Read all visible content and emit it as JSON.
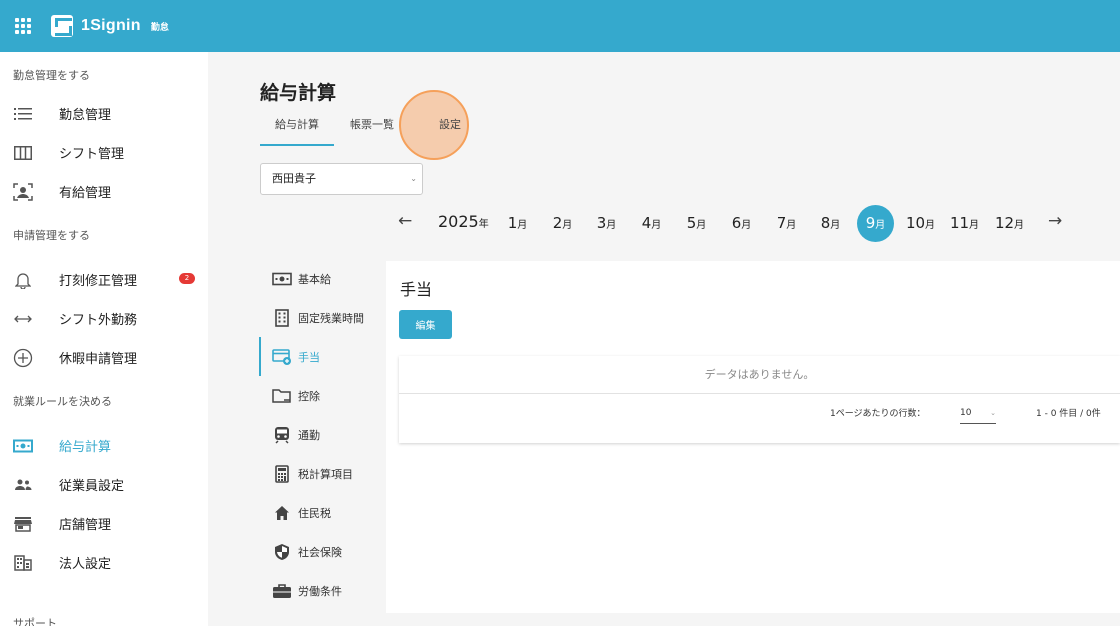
{
  "app": {
    "name": "1Signin",
    "sub": "勤怠"
  },
  "sidebar": {
    "sections": [
      {
        "title": "勤怠管理をする",
        "items": [
          {
            "label": "勤怠管理",
            "icon": "list-icon"
          },
          {
            "label": "シフト管理",
            "icon": "columns-icon"
          },
          {
            "label": "有給管理",
            "icon": "person-frame-icon"
          }
        ]
      },
      {
        "title": "申請管理をする",
        "items": [
          {
            "label": "打刻修正管理",
            "icon": "bell-icon",
            "badge": "2"
          },
          {
            "label": "シフト外勤務",
            "icon": "swap-arrows-icon"
          },
          {
            "label": "休暇申請管理",
            "icon": "plus-circle-icon"
          }
        ]
      },
      {
        "title": "就業ルールを決める",
        "items": [
          {
            "label": "給与計算",
            "icon": "money-icon",
            "active": true
          },
          {
            "label": "従業員設定",
            "icon": "people-icon"
          },
          {
            "label": "店舗管理",
            "icon": "store-icon"
          },
          {
            "label": "法人設定",
            "icon": "building-icon"
          }
        ]
      },
      {
        "title": "サポート",
        "items": []
      }
    ]
  },
  "page": {
    "title": "給与計算",
    "tabs": [
      {
        "label": "給与計算",
        "active": true
      },
      {
        "label": "帳票一覧"
      },
      {
        "label": "設定"
      }
    ],
    "employee_select": "西田貴子"
  },
  "month_nav": {
    "year": "2025",
    "year_suffix": "年",
    "month_suffix": "月",
    "months": [
      "1",
      "2",
      "3",
      "4",
      "5",
      "6",
      "7",
      "8",
      "9",
      "10",
      "11",
      "12"
    ],
    "selected": "9"
  },
  "subnav": [
    {
      "label": "基本給",
      "icon": "cash-icon"
    },
    {
      "label": "固定残業時間",
      "icon": "office-building-icon"
    },
    {
      "label": "手当",
      "icon": "card-plus-icon",
      "active": true
    },
    {
      "label": "控除",
      "icon": "folder-minus-icon"
    },
    {
      "label": "通勤",
      "icon": "train-icon"
    },
    {
      "label": "税計算項目",
      "icon": "calculator-icon"
    },
    {
      "label": "住民税",
      "icon": "home-icon"
    },
    {
      "label": "社会保険",
      "icon": "shield-icon"
    },
    {
      "label": "労働条件",
      "icon": "briefcase-icon"
    }
  ],
  "panel": {
    "title": "手当",
    "edit_label": "編集",
    "empty_message": "データはありません。",
    "rows_per_page_label": "1ページあたりの行数：",
    "rows_per_page": "10",
    "page_info": "1 - 0 件目 / 0件"
  },
  "colors": {
    "primary": "#35a9cd",
    "highlight": "#f5b07d",
    "badge": "#e53935"
  }
}
